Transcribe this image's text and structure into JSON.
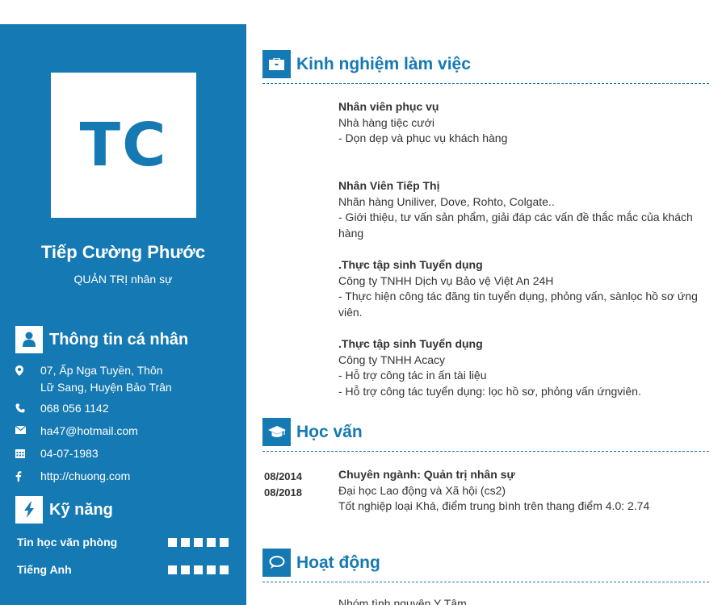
{
  "profile": {
    "initials": "TC",
    "name": "Tiếp Cường Phước",
    "role": "QUẢN TRỊ nhân sự"
  },
  "personal": {
    "heading": "Thông tin cá nhân",
    "address_line1": "07, Ấp Nga Tuyền, Thôn",
    "address_line2": "Lữ Sang, Huyện Bảo Trân",
    "phone": "068 056 1142",
    "email": "ha47@hotmail.com",
    "birthday": "04-07-1983",
    "website": "http://chuong.com"
  },
  "skills": {
    "heading": "Kỹ năng",
    "items": [
      {
        "name": "Tin học văn phòng",
        "level": 5
      },
      {
        "name": "Tiếng Anh",
        "level": 5
      }
    ]
  },
  "experience": {
    "heading": "Kinh nghiệm làm việc",
    "items": [
      {
        "title": "Nhân viên phục vụ",
        "company": "Nhà hàng tiệc cưới",
        "desc": "- Dọn dẹp và phục vụ khách hàng"
      },
      {
        "title": "Nhân Viên Tiếp Thị",
        "company": "Nhãn hàng Uniliver, Dove, Rohto, Colgate..",
        "desc": "- Giới thiệu, tư vấn sản phẩm, giải đáp các vấn đề thắc mắc của khách hàng"
      },
      {
        "title": ".Thực tập sinh Tuyển dụng",
        "company": "Công ty TNHH Dịch vụ Bảo vệ Việt An 24H",
        "desc": " - Thực hiện công tác đăng tin tuyển dụng, phỏng vấn, sànlọc hồ sơ ứng viên."
      },
      {
        "title": ".Thực tập sinh Tuyển dụng",
        "company": "Công ty TNHH Acacy",
        "desc": "- Hỗ trợ công tác in ấn tài liệu",
        "desc2": "- Hỗ trợ công tác tuyển dụng: lọc hồ sơ, phỏng vấn ứngviên."
      }
    ]
  },
  "education": {
    "heading": "Học vấn",
    "start": "08/2014",
    "end": "08/2018",
    "major": "Chuyên ngành: Quản trị nhân sự",
    "school": "Đại học Lao động và Xã hội (cs2)",
    "result": "Tốt nghiệp loại Khá, điểm trung bình trên thang điểm 4.0: 2.74"
  },
  "activities": {
    "heading": "Hoạt động",
    "first_item": "Nhóm tình nguyện Y Tâm"
  },
  "colors": {
    "accent": "#1579b3",
    "text": "#333333",
    "background": "#ffffff"
  }
}
